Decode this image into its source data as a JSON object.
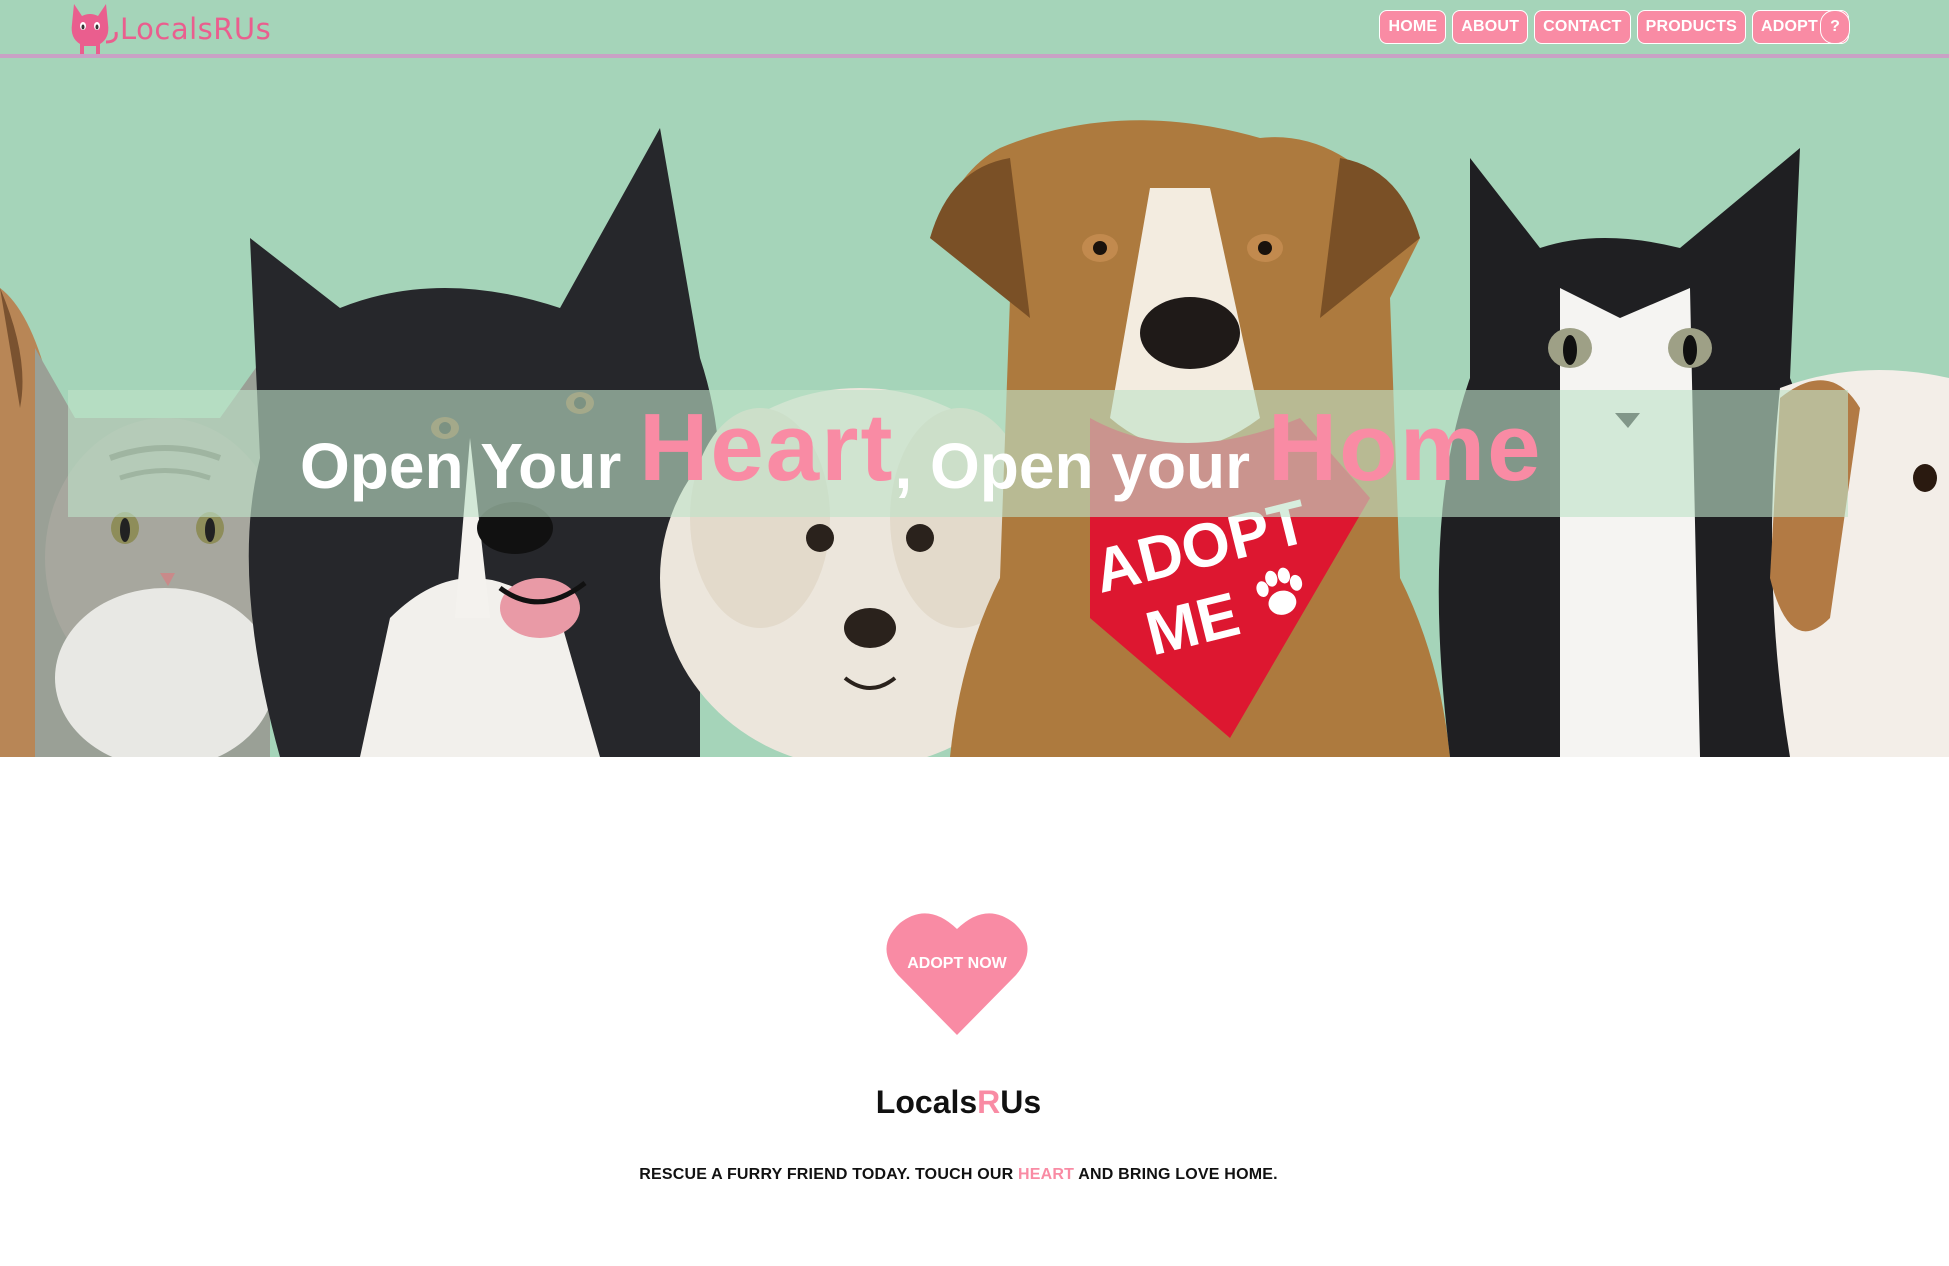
{
  "header": {
    "logo_text": "LocalsRUs",
    "nav": [
      {
        "label": "HOME"
      },
      {
        "label": "ABOUT"
      },
      {
        "label": "CONTACT"
      },
      {
        "label": "PRODUCTS"
      },
      {
        "label": "ADOPT"
      }
    ],
    "help_label": "?"
  },
  "hero": {
    "title_part1": "Open Your ",
    "title_word1": "Heart",
    "title_part2": ", Open your ",
    "title_word2": "Home",
    "bandana_line1": "ADOPT",
    "bandana_line2": "ME"
  },
  "cta": {
    "adopt_now_label": "ADOPT NOW"
  },
  "brand": {
    "part1": "Locals",
    "part2": "R",
    "part3": "Us"
  },
  "tagline": {
    "part1": "RESCUE A FURRY FRIEND TODAY. TOUCH OUR ",
    "highlight": "HEART",
    "part2": " AND BRING LOVE HOME."
  },
  "colors": {
    "accent_pink": "#f98ba4",
    "header_green": "#a5d4b9",
    "logo_pink": "#ea5e8e"
  }
}
